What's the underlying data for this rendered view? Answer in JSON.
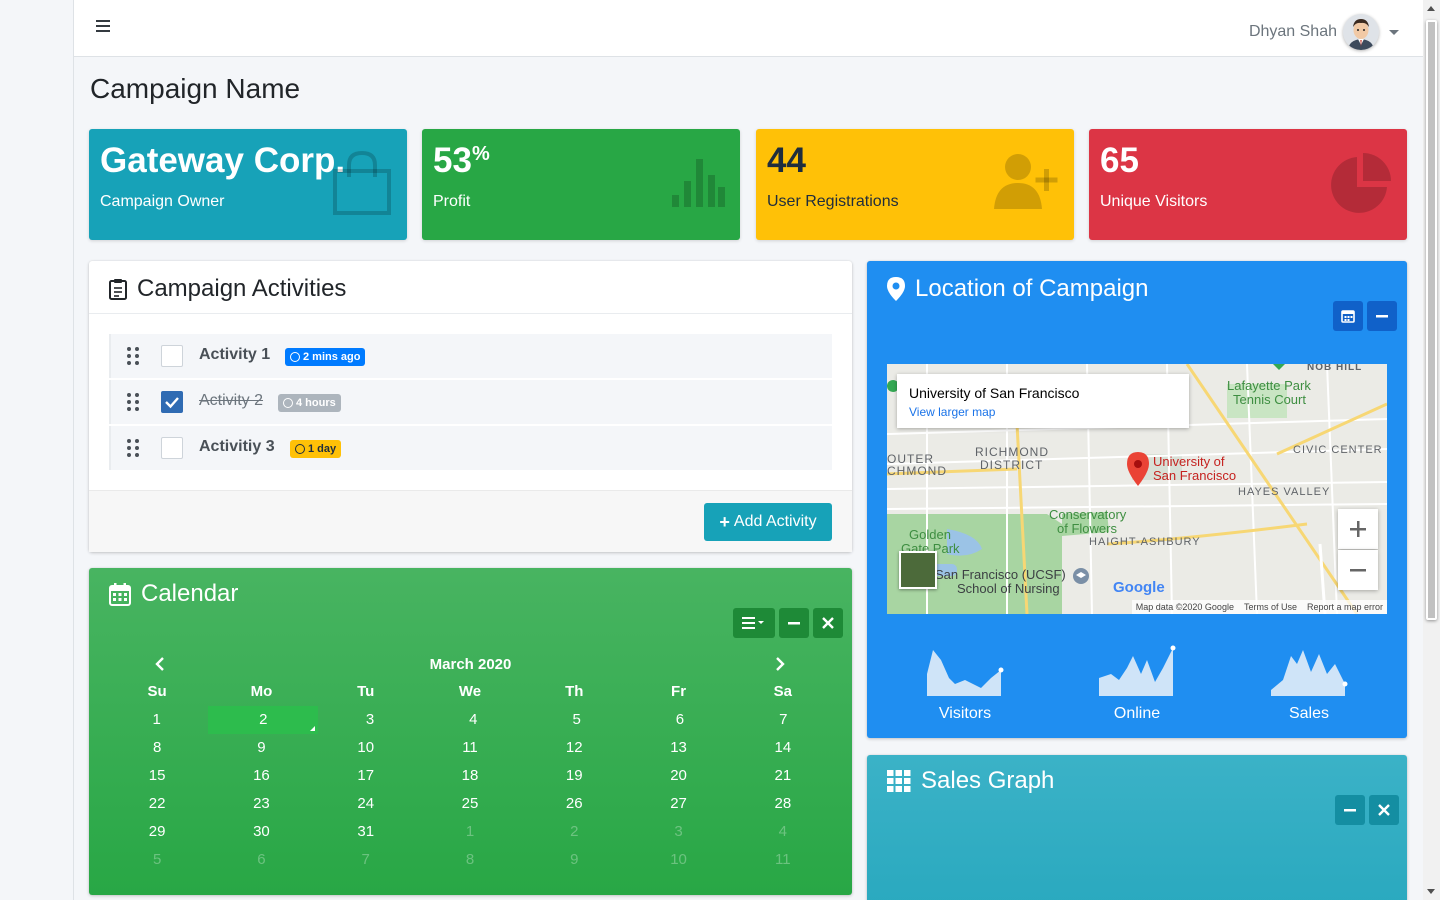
{
  "header": {
    "user_name": "Dhyan Shah"
  },
  "page": {
    "title": "Campaign Name"
  },
  "stat_boxes": [
    {
      "value": "Gateway Corp.",
      "label": "Campaign Owner",
      "icon": "shopping-bag-icon",
      "color": "#17a2b8"
    },
    {
      "value": "53",
      "suffix": "%",
      "label": "Profit",
      "icon": "bar-chart-icon",
      "color": "#28a745"
    },
    {
      "value": "44",
      "label": "User Registrations",
      "icon": "user-plus-icon",
      "color": "#ffc107"
    },
    {
      "value": "65",
      "label": "Unique Visitors",
      "icon": "pie-chart-icon",
      "color": "#dc3545"
    }
  ],
  "activities": {
    "title": "Campaign Activities",
    "items": [
      {
        "label": "Activity 1",
        "badge": "2 mins ago",
        "checked": false
      },
      {
        "label": "Activity 2",
        "badge": "4 hours",
        "checked": true
      },
      {
        "label": "Activitiy 3",
        "badge": "1 day",
        "checked": false
      }
    ],
    "add_button": "Add Activity"
  },
  "calendar": {
    "title": "Calendar",
    "month": "March 2020",
    "weekdays": [
      "Su",
      "Mo",
      "Tu",
      "We",
      "Th",
      "Fr",
      "Sa"
    ],
    "weeks": [
      [
        "1",
        "2",
        "3",
        "4",
        "5",
        "6",
        "7"
      ],
      [
        "8",
        "9",
        "10",
        "11",
        "12",
        "13",
        "14"
      ],
      [
        "15",
        "16",
        "17",
        "18",
        "19",
        "20",
        "21"
      ],
      [
        "22",
        "23",
        "24",
        "25",
        "26",
        "27",
        "28"
      ],
      [
        "29",
        "30",
        "31",
        "1",
        "2",
        "3",
        "4"
      ],
      [
        "5",
        "6",
        "7",
        "8",
        "9",
        "10",
        "11"
      ]
    ],
    "selected_day": "2"
  },
  "location": {
    "title": "Location of Campaign",
    "map_place": "University of San Francisco",
    "map_link": "View larger map",
    "map_labels": {
      "lafayette": "Lafayette Park",
      "tennis": "Tennis Court",
      "nob_hill": "NOB HILL",
      "richmond_dist": "RICHMOND",
      "district": "DISTRICT",
      "outer": "OUTER",
      "chmond": "CHMOND",
      "civic": "CIVIC CENTER",
      "hayes": "HAYES VALLEY",
      "conservatory": "Conservatory",
      "of_flowers": "of Flowers",
      "haight": "HAIGHT-ASHBURY",
      "golden": "Golden",
      "gate_park": "Gate Park",
      "ucsf": "San Francisco (UCSF)",
      "nursing": "School of Nursing",
      "usf1": "University of",
      "usf2": "San Francisco"
    },
    "map_footer": [
      "Map data ©2020 Google",
      "Terms of Use",
      "Report a map error"
    ],
    "google_text": "Google",
    "sparklines": [
      {
        "label": "Visitors"
      },
      {
        "label": "Online"
      },
      {
        "label": "Sales"
      }
    ]
  },
  "sales": {
    "title": "Sales Graph"
  }
}
